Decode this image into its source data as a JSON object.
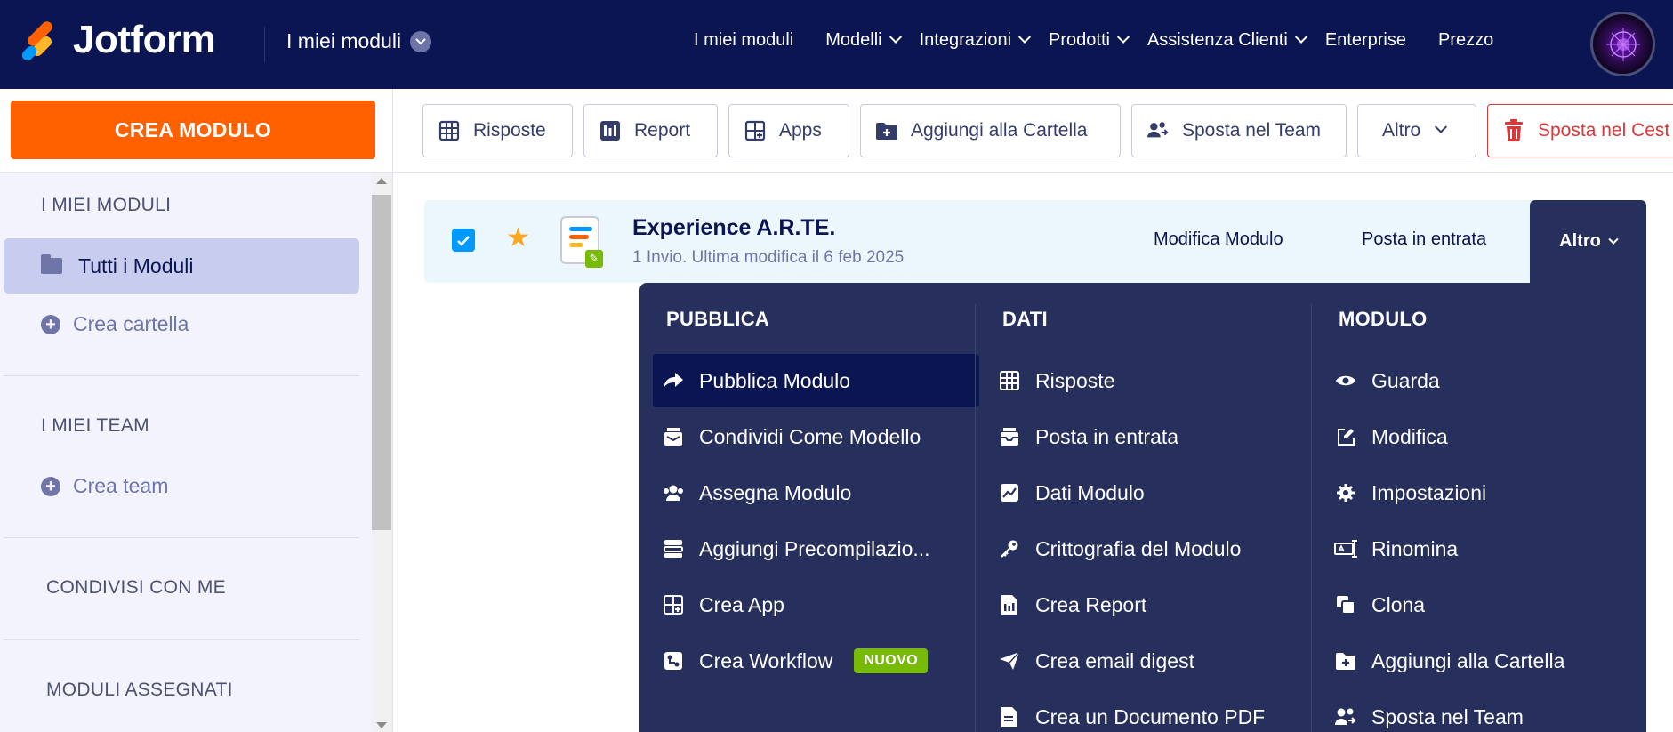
{
  "brand": {
    "name": "Jotform"
  },
  "workspace": {
    "title": "I miei moduli"
  },
  "topnav": {
    "links": [
      {
        "label": "I miei moduli"
      },
      {
        "label": "Modelli"
      },
      {
        "label": "Integrazioni"
      },
      {
        "label": "Prodotti"
      },
      {
        "label": "Assistenza Clienti"
      },
      {
        "label": "Enterprise"
      },
      {
        "label": "Prezzo"
      }
    ]
  },
  "sidebar": {
    "create_button": "CREA MODULO",
    "my_forms_heading": "I MIEI MODULI",
    "all_forms": "Tutti i Moduli",
    "create_folder": "Crea cartella",
    "my_teams_heading": "I MIEI TEAM",
    "create_team": "Crea team",
    "shared_heading": "CONDIVISI CON ME",
    "assigned_heading": "MODULI ASSEGNATI"
  },
  "toolbar": {
    "responses": "Risposte",
    "report": "Report",
    "apps": "Apps",
    "add_to_folder": "Aggiungi alla Cartella",
    "move_to_team": "Sposta nel Team",
    "more": "Altro",
    "trash": "Sposta nel Cest"
  },
  "form": {
    "title": "Experience A.R.TE.",
    "subtitle": "1 Invio. Ultima modifica il 6 feb 2025",
    "edit": "Modifica Modulo",
    "inbox": "Posta in entrata",
    "more": "Altro"
  },
  "dropdown": {
    "publish": {
      "heading": "PUBBLICA",
      "items": [
        {
          "label": "Pubblica Modulo",
          "icon": "share-arrow-icon"
        },
        {
          "label": "Condividi Come Modello",
          "icon": "template-icon"
        },
        {
          "label": "Assegna Modulo",
          "icon": "users-icon"
        },
        {
          "label": "Aggiungi Precompilazio...",
          "icon": "prefill-icon"
        },
        {
          "label": "Crea App",
          "icon": "app-icon"
        },
        {
          "label": "Crea Workflow",
          "icon": "workflow-icon",
          "badge": "NUOVO"
        }
      ]
    },
    "data": {
      "heading": "DATI",
      "items": [
        {
          "label": "Risposte",
          "icon": "table-icon"
        },
        {
          "label": "Posta in entrata",
          "icon": "inbox-icon"
        },
        {
          "label": "Dati Modulo",
          "icon": "chart-icon"
        },
        {
          "label": "Crittografia del Modulo",
          "icon": "key-icon"
        },
        {
          "label": "Crea Report",
          "icon": "report-icon"
        },
        {
          "label": "Crea email digest",
          "icon": "send-icon"
        },
        {
          "label": "Crea un Documento PDF",
          "icon": "pdf-icon"
        }
      ]
    },
    "form": {
      "heading": "MODULO",
      "items": [
        {
          "label": "Guarda",
          "icon": "eye-icon"
        },
        {
          "label": "Modifica",
          "icon": "edit-icon"
        },
        {
          "label": "Impostazioni",
          "icon": "gear-icon"
        },
        {
          "label": "Rinomina",
          "icon": "rename-icon"
        },
        {
          "label": "Clona",
          "icon": "clone-icon"
        },
        {
          "label": "Aggiungi alla Cartella",
          "icon": "folder-plus-icon"
        },
        {
          "label": "Sposta nel Team",
          "icon": "team-move-icon"
        }
      ]
    }
  },
  "colors": {
    "navy": "#0a1551",
    "orange": "#ff6100",
    "dropdown_bg": "#272f5c",
    "accent_blue": "#0099ff",
    "green_badge": "#78bb07",
    "danger": "#d93838"
  }
}
